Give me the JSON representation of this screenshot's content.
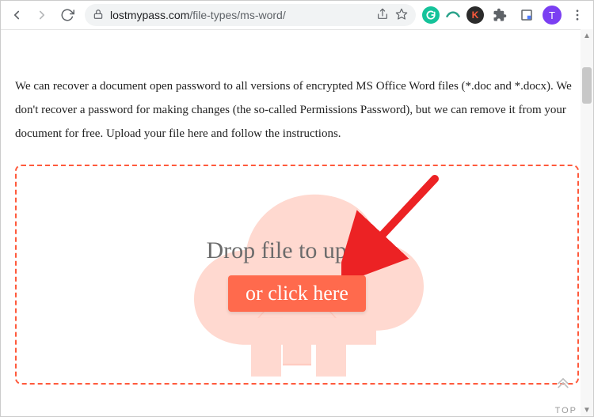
{
  "browser": {
    "url_host": "lostmypass.com",
    "url_path": "/file-types/ms-word/",
    "avatar_initial": "T",
    "ext_k": "K"
  },
  "page": {
    "description": "We can recover a document open password to all versions of encrypted MS Office Word files (*.doc and *.docx). We don't recover a password for making changes (the so-called Permissions Password), but we can remove it from your document for free. Upload your file here and follow the instructions.",
    "drop_title": "Drop file to upload",
    "drop_button": "or click here",
    "top_label": "TOP"
  }
}
